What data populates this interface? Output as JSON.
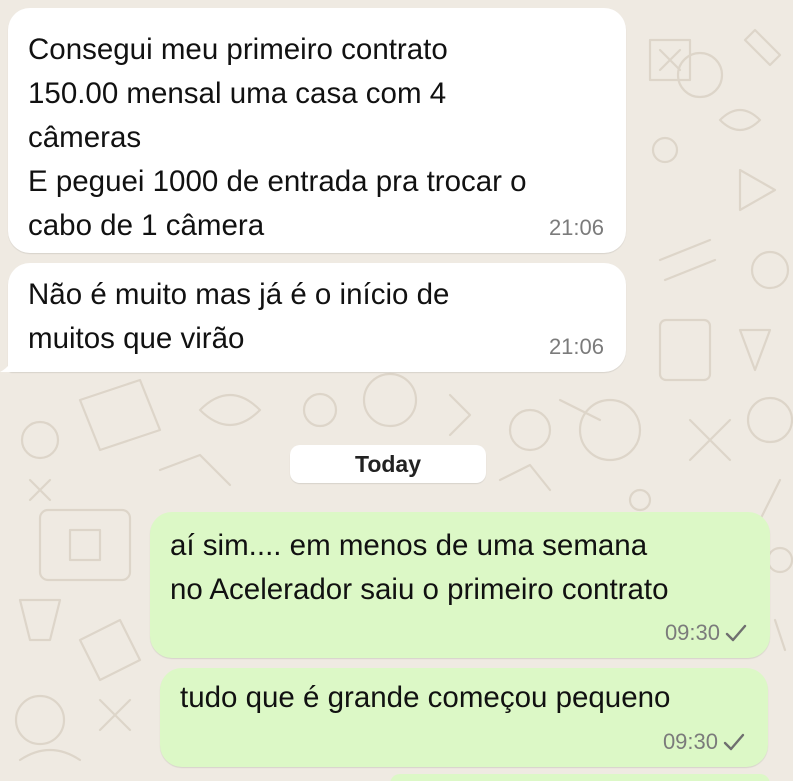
{
  "chat": {
    "messages": [
      {
        "direction": "incoming",
        "lines": [
          "Consegui meu primeiro contrato",
          "150.00 mensal uma casa com 4",
          "câmeras",
          "E peguei 1000 de entrada pra trocar o",
          "cabo de 1 câmera"
        ],
        "time": "21:06"
      },
      {
        "direction": "incoming",
        "lines": [
          "Não é muito mas já é o início de",
          "muitos que virão"
        ],
        "time": "21:06"
      },
      {
        "direction": "outgoing",
        "lines": [
          "aí sim.... em menos de uma semana",
          "no Acelerador saiu o primeiro contrato"
        ],
        "time": "09:30",
        "status_icon": "single-check-icon"
      },
      {
        "direction": "outgoing",
        "lines": [
          "tudo que é grande começou pequeno"
        ],
        "time": "09:30",
        "status_icon": "single-check-icon"
      }
    ],
    "date_separator": "Today"
  },
  "colors": {
    "wallpaper": "#efeae2",
    "incoming_bubble": "#ffffff",
    "outgoing_bubble": "#dcf8c6",
    "timestamp": "#7b7b7b"
  }
}
